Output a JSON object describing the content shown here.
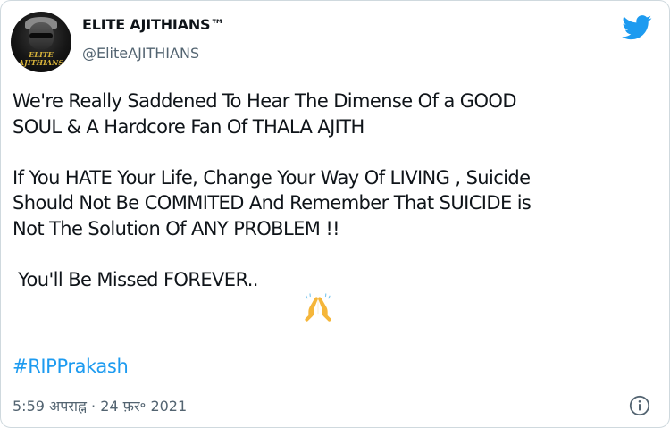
{
  "tweet": {
    "author": {
      "display_name": "ELITE AJITHIANS™",
      "handle": "@EliteAJITHIANS",
      "avatar_text": "ELITE\nAJITHIANS"
    },
    "text": "We're Really Saddened To Hear The Dimense Of a GOOD\nSOUL & A Hardcore Fan Of THALA AJITH\n\nIf You HATE Your Life, Change Your Way Of LIVING , Suicide\nShould Not Be COMMITED And Remember That SUICIDE is\nNot The Solution Of ANY PROBLEM !!\n\n You'll Be Missed FOREVER..",
    "emoji": "folded-hands",
    "hashtag": "#RIPPrakash",
    "timestamp": "5:59 अपराह्न · 24 फ़र॰ 2021"
  },
  "icons": {
    "brand": "twitter-bird-icon",
    "info": "info-icon"
  },
  "colors": {
    "brand": "#1d9bf0",
    "hashtag": "#1d9bf0",
    "secondary_text": "#536471",
    "border": "#cfd9de"
  }
}
